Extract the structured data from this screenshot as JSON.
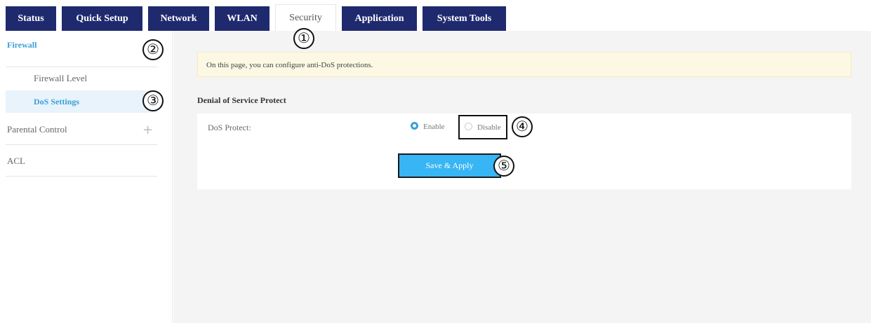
{
  "tabs": [
    {
      "label": "Status"
    },
    {
      "label": "Quick Setup"
    },
    {
      "label": "Network"
    },
    {
      "label": "WLAN"
    },
    {
      "label": "Security"
    },
    {
      "label": "Application"
    },
    {
      "label": "System Tools"
    }
  ],
  "sidebar": {
    "firewall": "Firewall",
    "firewall_level": "Firewall Level",
    "dos_settings": "DoS Settings",
    "parental_control": "Parental Control",
    "parental_expand": "+",
    "acl": "ACL"
  },
  "main": {
    "notice": "On this page, you can configure anti-DoS protections.",
    "section_title": "Denial of Service Protect",
    "dos_label": "DoS Protect:",
    "enable_label": "Enable",
    "disable_label": "Disable",
    "selected": "Enable",
    "apply_label": "Save & Apply"
  },
  "callouts": [
    "①",
    "②",
    "③",
    "④",
    "⑤"
  ],
  "colors": {
    "tab_bg": "#1f2a6e",
    "accent": "#3a9fd8",
    "apply_bg": "#37b5f4",
    "notice_bg": "#fcf8e3"
  }
}
